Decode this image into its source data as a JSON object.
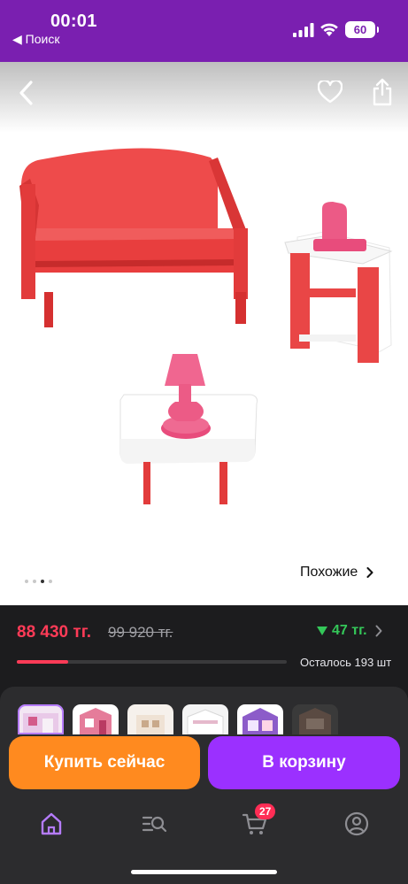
{
  "status_bar": {
    "time": "00:01",
    "back_app": "◀ Поиск",
    "battery": "60"
  },
  "product": {
    "images_count": 4,
    "active_image": 3,
    "similar_label": "Похожие"
  },
  "pricing": {
    "price": "88 430 тг.",
    "old_price": "99 920 тг.",
    "bonus": "47 тг.",
    "stock_text": "Осталось 193 шт",
    "stock_progress": 0.19
  },
  "actions": {
    "buy_now": "Купить сейчас",
    "add_to_cart": "В корзину"
  },
  "tabbar": {
    "items": [
      "home-icon",
      "catalog-search-icon",
      "cart-icon",
      "profile-icon"
    ],
    "cart_badge": "27"
  },
  "colors": {
    "accent_purple": "#9b30ff",
    "status_purple": "#7a1fb0",
    "buy_orange": "#ff8a1f",
    "price_red": "#ff3b57",
    "bonus_green": "#34c759"
  }
}
